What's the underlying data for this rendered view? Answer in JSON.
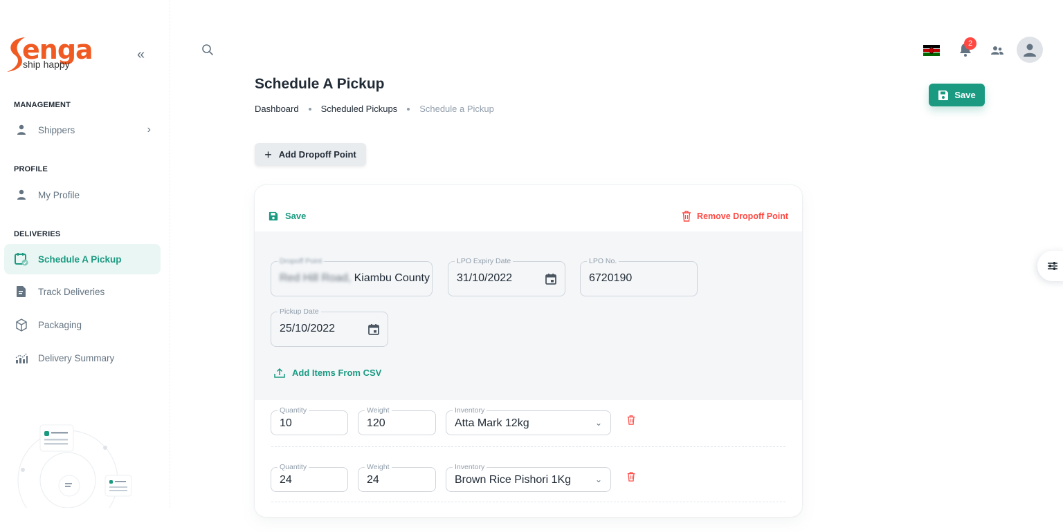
{
  "brand": {
    "name": "enga",
    "tagline": "ship happy"
  },
  "sidebar": {
    "sections": [
      {
        "title": "MANAGEMENT",
        "items": [
          {
            "label": "Shippers",
            "icon": "person-icon",
            "has_children": true
          }
        ]
      },
      {
        "title": "PROFILE",
        "items": [
          {
            "label": "My Profile",
            "icon": "person-icon"
          }
        ]
      },
      {
        "title": "DELIVERIES",
        "items": [
          {
            "label": "Schedule A Pickup",
            "icon": "calendar-check-icon",
            "active": true
          },
          {
            "label": "Track Deliveries",
            "icon": "document-icon"
          },
          {
            "label": "Packaging",
            "icon": "box-icon"
          },
          {
            "label": "Delivery Summary",
            "icon": "bar-chart-icon"
          }
        ]
      }
    ]
  },
  "topbar": {
    "notification_count": "2",
    "flag_country": "Kenya"
  },
  "header": {
    "title": "Schedule A Pickup",
    "breadcrumb": [
      "Dashboard",
      "Scheduled Pickups",
      "Schedule a Pickup"
    ],
    "save_label": "Save",
    "add_dropoff_label": "Add Dropoff Point"
  },
  "card": {
    "save_label": "Save",
    "remove_label": "Remove Dropoff Point",
    "fields": {
      "dropoff_point": {
        "label": "Dropoff Point",
        "value_visible": "Kiambu County",
        "value_blurred": "Red Hill Road,"
      },
      "lpo_expiry": {
        "label": "LPO Expiry Date",
        "value": "31/10/2022"
      },
      "lpo_no": {
        "label": "LPO No.",
        "value": "6720190"
      },
      "pickup_date": {
        "label": "Pickup Date",
        "value": "25/10/2022"
      }
    },
    "csv_label": "Add Items From CSV",
    "items": [
      {
        "quantity_label": "Quantity",
        "quantity": "10",
        "weight_label": "Weight",
        "weight": "120",
        "inventory_label": "Inventory",
        "inventory": "Atta Mark 12kg"
      },
      {
        "quantity_label": "Quantity",
        "quantity": "24",
        "weight_label": "Weight",
        "weight": "24",
        "inventory_label": "Inventory",
        "inventory": "Brown Rice Pishori 1Kg"
      }
    ]
  },
  "colors": {
    "accent": "#1b9a82",
    "danger": "#ff4842",
    "brand": "#f05a23"
  }
}
